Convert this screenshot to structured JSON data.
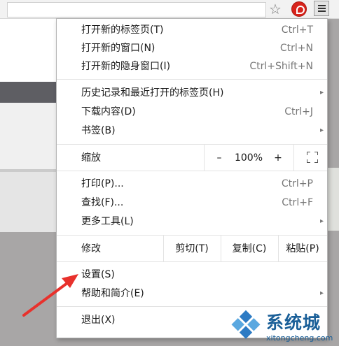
{
  "menu": {
    "groups": [
      [
        {
          "label": "打开新的标签页(T)",
          "shortcut": "Ctrl+T"
        },
        {
          "label": "打开新的窗口(N)",
          "shortcut": "Ctrl+N"
        },
        {
          "label": "打开新的隐身窗口(I)",
          "shortcut": "Ctrl+Shift+N"
        }
      ],
      [
        {
          "label": "历史记录和最近打开的标签页(H)",
          "submenu": true
        },
        {
          "label": "下载内容(D)",
          "shortcut": "Ctrl+J"
        },
        {
          "label": "书签(B)",
          "submenu": true
        }
      ],
      [
        {
          "label": "打印(P)...",
          "shortcut": "Ctrl+P"
        },
        {
          "label": "查找(F)...",
          "shortcut": "Ctrl+F"
        },
        {
          "label": "更多工具(L)",
          "submenu": true
        }
      ],
      [
        {
          "label": "设置(S)"
        },
        {
          "label": "帮助和简介(E)",
          "submenu": true
        }
      ],
      [
        {
          "label": "退出(X)"
        }
      ]
    ],
    "zoom": {
      "label": "缩放",
      "minus": "–",
      "value": "100%",
      "plus": "+"
    },
    "edit": {
      "label": "修改",
      "cut": "剪切(T)",
      "copy": "复制(C)",
      "paste": "粘贴(P)"
    },
    "submenu_arrow": "▸"
  },
  "toolbar": {
    "star_icon": "☆"
  },
  "icons": {
    "extension": "red-extension-icon",
    "menu": "hamburger-menu-icon"
  },
  "watermark": {
    "title": "系统城",
    "url": "xitongcheng.com"
  },
  "colors": {
    "annotation_arrow": "#e8312c",
    "watermark": "#1a5f98",
    "extension": "#d8231b"
  }
}
